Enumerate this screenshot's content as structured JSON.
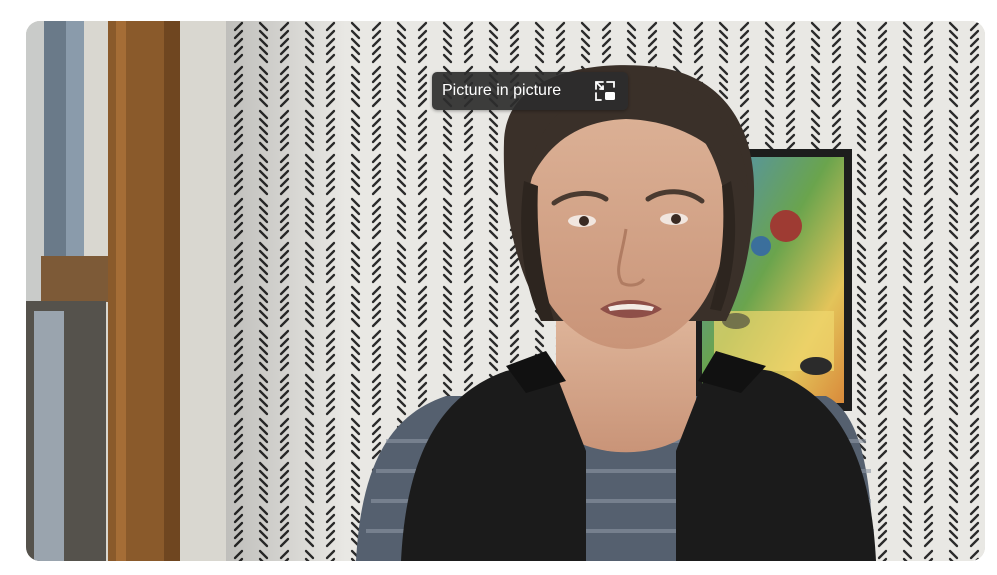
{
  "pip_button": {
    "label": "Picture in picture",
    "icon": "picture-in-picture-icon"
  },
  "colors": {
    "tooltip_bg": "#2c2c2c",
    "tooltip_text": "#ffffff",
    "wall": "#e9e8e4",
    "wall_marks": "#2b2b2b",
    "door_frame": "#8a5a2b",
    "vest": "#1b1b1b",
    "shirt": "#55606f",
    "hair": "#3a3029",
    "skin": "#d7a98c"
  }
}
